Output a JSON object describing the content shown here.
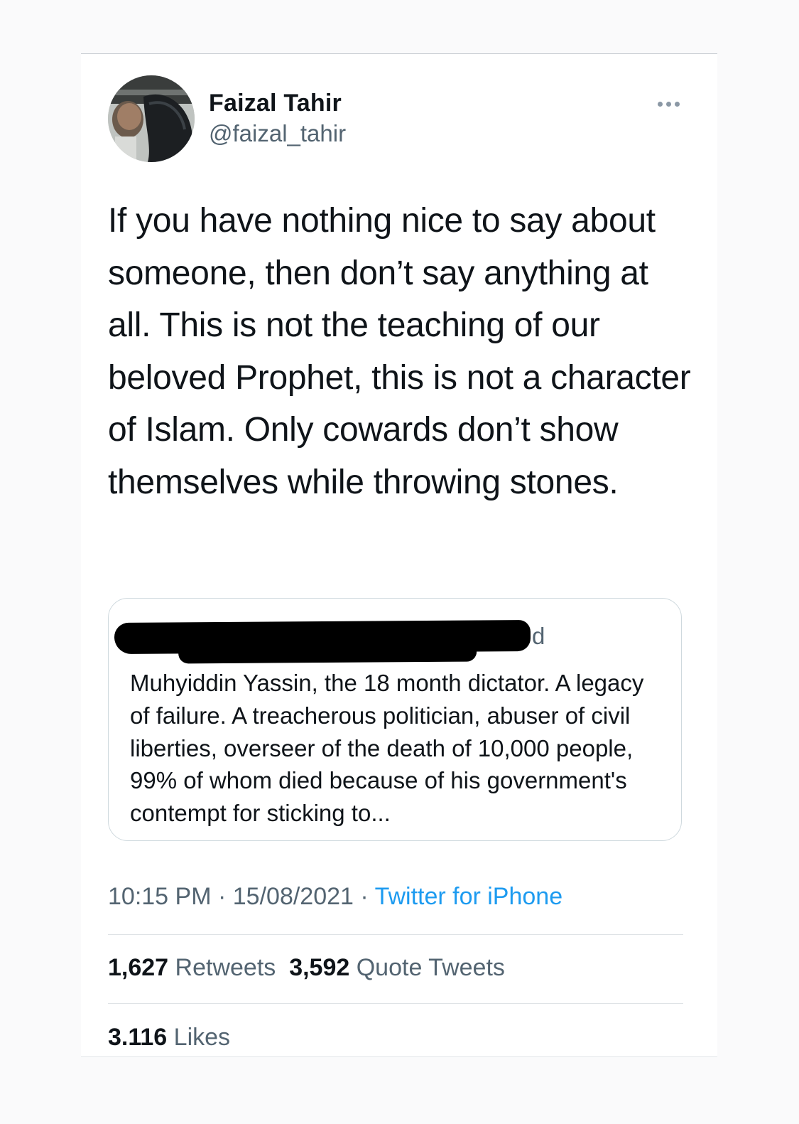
{
  "tweet": {
    "author": {
      "name": "Faizal Tahir",
      "handle": "@faizal_tahir"
    },
    "more_icon": "more-horizontal-icon",
    "text": "If you have nothing nice to say about someone, then don’t say anything at all. This is not the teaching of our beloved Prophet, this is not a character of Islam. Only cowards don’t show themselves while throwing stones.",
    "quoted": {
      "time": "d",
      "text": "Muhyiddin Yassin, the 18 month dictator. A legacy of failure. A treacherous politician, abuser of civil liberties, overseer of the death of 10,000 people, 99% of whom died because of his government's contempt for sticking to..."
    },
    "meta": {
      "time": "10:15 PM",
      "separator": "·",
      "date": "15/08/2021",
      "source": "Twitter for iPhone"
    },
    "stats": {
      "retweets_count": "1,627",
      "retweets_label": "Retweets",
      "quote_count": "3,592",
      "quote_label": "Quote Tweets",
      "likes_count": "3.116",
      "likes_label": "Likes"
    }
  },
  "colors": {
    "text": "#0f1419",
    "secondary": "#536471",
    "link": "#1d9bf0",
    "border": "#cfd9de"
  }
}
